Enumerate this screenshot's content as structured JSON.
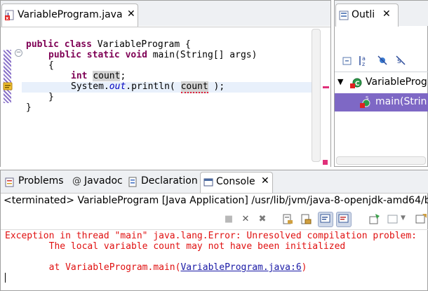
{
  "editor": {
    "tab_title": "VariableProgram.java",
    "close_glyph": "✕",
    "code": {
      "l1_kw1": "public",
      "l1_kw2": "class",
      "l1_rest": " VariableProgram {",
      "l2_kw1": "public",
      "l2_kw2": "static",
      "l2_kw3": "void",
      "l2_rest": " main(String[] args)",
      "l3": "{",
      "l4_kw": "int",
      "l4_var": "count",
      "l4_end": ";",
      "l5_pre": "System.",
      "l5_field": "out",
      "l5_mid": ".println( ",
      "l5_var": "count",
      "l5_end": " );",
      "l6": "}",
      "l7": "}"
    }
  },
  "outline": {
    "tab_title": "Outli",
    "close_glyph": "✕",
    "tree": [
      {
        "label": "VariableProgr"
      },
      {
        "label": "main(Strin"
      }
    ]
  },
  "bottom": {
    "tabs": [
      {
        "label": "Problems"
      },
      {
        "label": "Javadoc"
      },
      {
        "label": "Declaration"
      },
      {
        "label": "Console"
      }
    ],
    "console_close_glyph": "✕",
    "console_header": "<terminated> VariableProgram [Java Application] /usr/lib/jvm/java-8-openjdk-amd64/b",
    "output": {
      "line1": "Exception in thread \"main\" java.lang.Error: Unresolved compilation problem:",
      "line2": "        The local variable count may not have been initialized",
      "line4_pre": "        at VariableProgram.main(",
      "line4_link": "VariableProgram.java:6",
      "line4_post": ")"
    }
  },
  "colors": {
    "keyword": "#7f0055",
    "error_text": "#e01010",
    "selection": "#7e68c5",
    "link": "#1a1aa6"
  }
}
